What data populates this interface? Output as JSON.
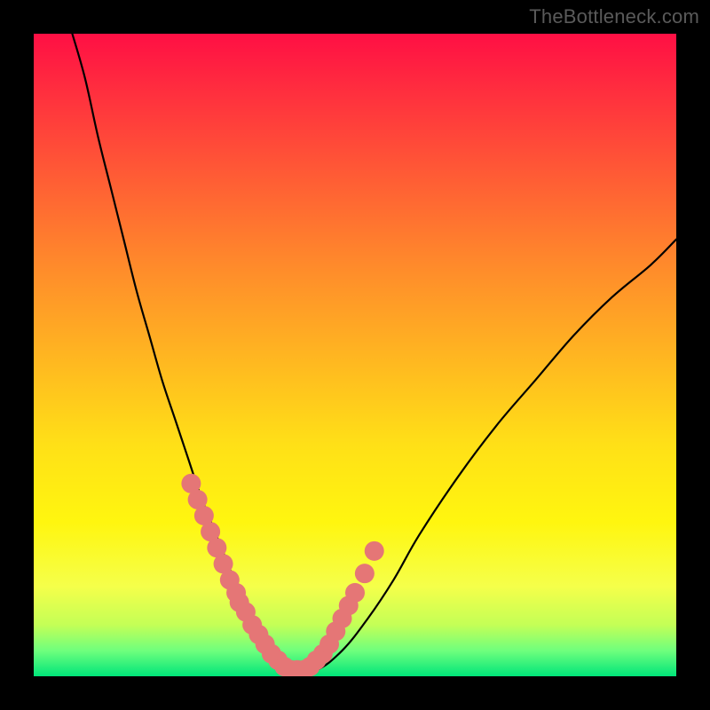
{
  "watermark": {
    "text": "TheBottleneck.com"
  },
  "colors": {
    "curve": "#000000",
    "dot_fill": "#e57676",
    "dot_stroke": "#d06060"
  },
  "chart_data": {
    "type": "line",
    "title": "",
    "xlabel": "",
    "ylabel": "",
    "xlim": [
      0,
      100
    ],
    "ylim": [
      0,
      100
    ],
    "series": [
      {
        "name": "bottleneck-curve",
        "x": [
          6,
          8,
          10,
          12,
          14,
          16,
          18,
          20,
          22,
          24,
          26,
          28,
          30,
          32,
          34,
          36,
          38,
          40,
          44,
          48,
          52,
          56,
          60,
          66,
          72,
          78,
          84,
          90,
          96,
          100
        ],
        "y": [
          100,
          93,
          84,
          76,
          68,
          60,
          53,
          46,
          40,
          34,
          28,
          23,
          18,
          13,
          9,
          6,
          3,
          1,
          1,
          4,
          9,
          15,
          22,
          31,
          39,
          46,
          53,
          59,
          64,
          68
        ]
      }
    ],
    "dots": {
      "name": "highlight-dots",
      "x": [
        24.5,
        25.5,
        26.5,
        27.5,
        28.5,
        29.5,
        30.5,
        31.5,
        32.0,
        33.0,
        34.0,
        35.0,
        36.0,
        37.0,
        38.0,
        39.0,
        40.0,
        41.0,
        42.0,
        43.0,
        44.0,
        45.0,
        46.0,
        47.0,
        48.0,
        49.0,
        50.0,
        51.5,
        53.0
      ],
      "y": [
        30.0,
        27.5,
        25.0,
        22.5,
        20.0,
        17.5,
        15.0,
        13.0,
        11.5,
        10.0,
        8.0,
        6.5,
        5.0,
        3.5,
        2.5,
        1.5,
        1.0,
        1.0,
        1.0,
        1.5,
        2.5,
        3.5,
        5.0,
        7.0,
        9.0,
        11.0,
        13.0,
        16.0,
        19.5
      ],
      "radius_px": 11
    }
  }
}
